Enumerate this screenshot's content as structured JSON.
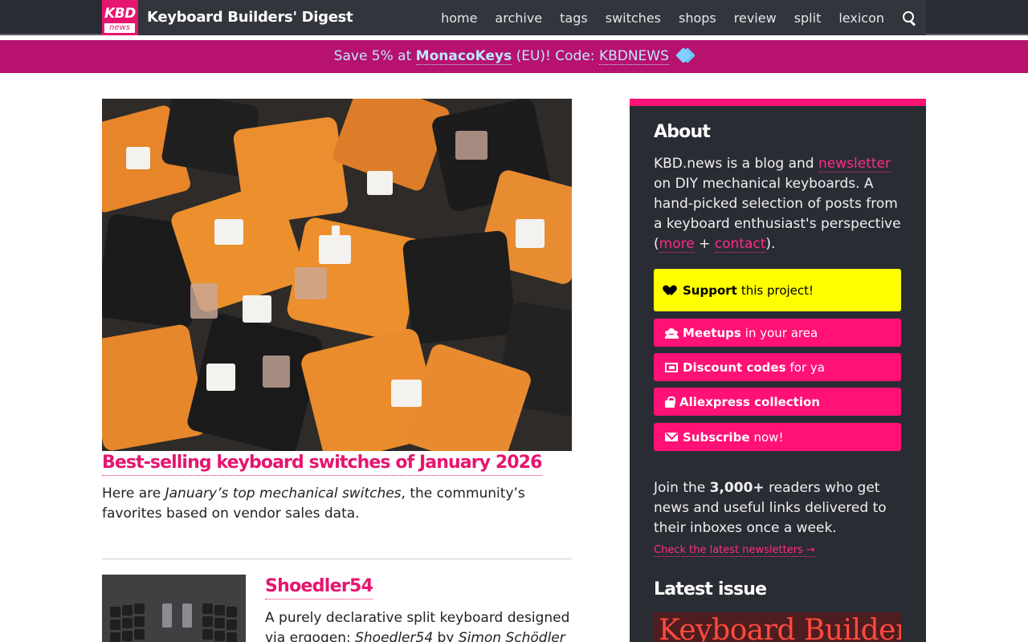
{
  "header": {
    "logo_top": "KBD",
    "logo_bottom": "news",
    "site_title": "Keyboard Builders' Digest",
    "nav": [
      "home",
      "archive",
      "tags",
      "switches",
      "shops",
      "review",
      "split",
      "lexicon"
    ],
    "search_icon": "search-icon"
  },
  "promo": {
    "prefix": "Save 5% at",
    "shop": "MonacoKeys",
    "middle": "(EU)! Code:",
    "code": "KBDNEWS",
    "icon": "tags-icon"
  },
  "hero": {
    "title": "Best-selling keyboard switches of January 2026",
    "excerpt_before": "Here are",
    "excerpt_italic": "January’s top mechanical switches",
    "excerpt_after": ", the community’s favorites based on vendor sales data."
  },
  "post2": {
    "title": "Shoedler54",
    "excerpt_before": "A purely declarative split keyboard designed via ergogen:",
    "excerpt_italic1": "Shoedler54",
    "excerpt_mid": "by",
    "excerpt_italic2": "Simon Schödler"
  },
  "sidebar": {
    "about_heading": "About",
    "about_t1": "KBD.news is a blog and",
    "about_link_newsletter": "newsletter",
    "about_t2": "on DIY mechanical keyboards. A hand-picked selection of posts from a keyboard enthusiast's perspective (",
    "about_link_more": "more",
    "about_plus": "+",
    "about_link_contact": "contact",
    "about_end": ").",
    "buttons": [
      {
        "bold": "Support",
        "rest": "this project!",
        "icon": "heart-icon"
      },
      {
        "bold": "Meetups",
        "rest": "in your area",
        "icon": "users-icon"
      },
      {
        "bold": "Discount codes",
        "rest": "for ya",
        "icon": "ticket-icon"
      },
      {
        "bold": "Aliexpress collection",
        "rest": "",
        "icon": "shopping-bag-icon"
      },
      {
        "bold": "Subscribe",
        "rest": "now!",
        "icon": "envelope-icon"
      }
    ],
    "join_t1": "Join the",
    "join_bold": "3,000+",
    "join_t2": "readers who get news and useful links delivered to their inboxes once a week.",
    "newsletters_link": "Check the latest newsletters →",
    "latest_heading": "Latest issue",
    "latest_issue_image_text": "Keyboard Builders’ Digest"
  },
  "colors": {
    "accent": "#e6156f",
    "nav_bg": "#2a2c34",
    "promo_bg": "#b6126e",
    "support_yellow": "#ffff00"
  }
}
